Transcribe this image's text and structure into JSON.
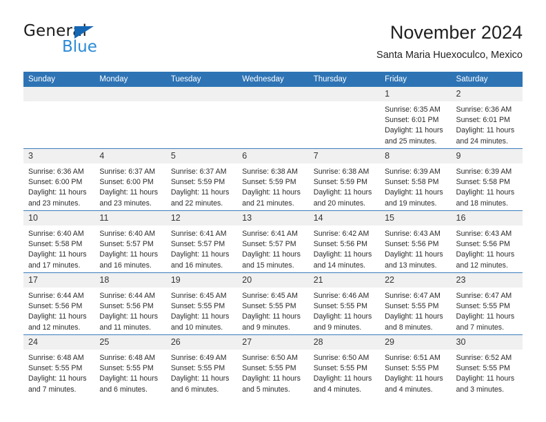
{
  "brand": {
    "name_part1": "General",
    "name_part2": "Blue",
    "triangle_icon": "triangle-icon",
    "colors": {
      "dark": "#1b1b1b",
      "blue": "#2b8ad6",
      "triangle": "#1567b3"
    }
  },
  "header": {
    "title": "November 2024",
    "subtitle": "Santa Maria Huexoculco, Mexico"
  },
  "calendar": {
    "accent_color": "#2e74b5",
    "daynum_band_color": "#f0f0f0",
    "weekdays": [
      "Sunday",
      "Monday",
      "Tuesday",
      "Wednesday",
      "Thursday",
      "Friday",
      "Saturday"
    ],
    "weeks": [
      [
        {
          "day": "",
          "sunrise": "",
          "sunset": "",
          "daylight": "",
          "empty": true
        },
        {
          "day": "",
          "sunrise": "",
          "sunset": "",
          "daylight": "",
          "empty": true
        },
        {
          "day": "",
          "sunrise": "",
          "sunset": "",
          "daylight": "",
          "empty": true
        },
        {
          "day": "",
          "sunrise": "",
          "sunset": "",
          "daylight": "",
          "empty": true
        },
        {
          "day": "",
          "sunrise": "",
          "sunset": "",
          "daylight": "",
          "empty": true
        },
        {
          "day": "1",
          "sunrise": "Sunrise: 6:35 AM",
          "sunset": "Sunset: 6:01 PM",
          "daylight": "Daylight: 11 hours and 25 minutes."
        },
        {
          "day": "2",
          "sunrise": "Sunrise: 6:36 AM",
          "sunset": "Sunset: 6:01 PM",
          "daylight": "Daylight: 11 hours and 24 minutes."
        }
      ],
      [
        {
          "day": "3",
          "sunrise": "Sunrise: 6:36 AM",
          "sunset": "Sunset: 6:00 PM",
          "daylight": "Daylight: 11 hours and 23 minutes."
        },
        {
          "day": "4",
          "sunrise": "Sunrise: 6:37 AM",
          "sunset": "Sunset: 6:00 PM",
          "daylight": "Daylight: 11 hours and 23 minutes."
        },
        {
          "day": "5",
          "sunrise": "Sunrise: 6:37 AM",
          "sunset": "Sunset: 5:59 PM",
          "daylight": "Daylight: 11 hours and 22 minutes."
        },
        {
          "day": "6",
          "sunrise": "Sunrise: 6:38 AM",
          "sunset": "Sunset: 5:59 PM",
          "daylight": "Daylight: 11 hours and 21 minutes."
        },
        {
          "day": "7",
          "sunrise": "Sunrise: 6:38 AM",
          "sunset": "Sunset: 5:59 PM",
          "daylight": "Daylight: 11 hours and 20 minutes."
        },
        {
          "day": "8",
          "sunrise": "Sunrise: 6:39 AM",
          "sunset": "Sunset: 5:58 PM",
          "daylight": "Daylight: 11 hours and 19 minutes."
        },
        {
          "day": "9",
          "sunrise": "Sunrise: 6:39 AM",
          "sunset": "Sunset: 5:58 PM",
          "daylight": "Daylight: 11 hours and 18 minutes."
        }
      ],
      [
        {
          "day": "10",
          "sunrise": "Sunrise: 6:40 AM",
          "sunset": "Sunset: 5:58 PM",
          "daylight": "Daylight: 11 hours and 17 minutes."
        },
        {
          "day": "11",
          "sunrise": "Sunrise: 6:40 AM",
          "sunset": "Sunset: 5:57 PM",
          "daylight": "Daylight: 11 hours and 16 minutes."
        },
        {
          "day": "12",
          "sunrise": "Sunrise: 6:41 AM",
          "sunset": "Sunset: 5:57 PM",
          "daylight": "Daylight: 11 hours and 16 minutes."
        },
        {
          "day": "13",
          "sunrise": "Sunrise: 6:41 AM",
          "sunset": "Sunset: 5:57 PM",
          "daylight": "Daylight: 11 hours and 15 minutes."
        },
        {
          "day": "14",
          "sunrise": "Sunrise: 6:42 AM",
          "sunset": "Sunset: 5:56 PM",
          "daylight": "Daylight: 11 hours and 14 minutes."
        },
        {
          "day": "15",
          "sunrise": "Sunrise: 6:43 AM",
          "sunset": "Sunset: 5:56 PM",
          "daylight": "Daylight: 11 hours and 13 minutes."
        },
        {
          "day": "16",
          "sunrise": "Sunrise: 6:43 AM",
          "sunset": "Sunset: 5:56 PM",
          "daylight": "Daylight: 11 hours and 12 minutes."
        }
      ],
      [
        {
          "day": "17",
          "sunrise": "Sunrise: 6:44 AM",
          "sunset": "Sunset: 5:56 PM",
          "daylight": "Daylight: 11 hours and 12 minutes."
        },
        {
          "day": "18",
          "sunrise": "Sunrise: 6:44 AM",
          "sunset": "Sunset: 5:56 PM",
          "daylight": "Daylight: 11 hours and 11 minutes."
        },
        {
          "day": "19",
          "sunrise": "Sunrise: 6:45 AM",
          "sunset": "Sunset: 5:55 PM",
          "daylight": "Daylight: 11 hours and 10 minutes."
        },
        {
          "day": "20",
          "sunrise": "Sunrise: 6:45 AM",
          "sunset": "Sunset: 5:55 PM",
          "daylight": "Daylight: 11 hours and 9 minutes."
        },
        {
          "day": "21",
          "sunrise": "Sunrise: 6:46 AM",
          "sunset": "Sunset: 5:55 PM",
          "daylight": "Daylight: 11 hours and 9 minutes."
        },
        {
          "day": "22",
          "sunrise": "Sunrise: 6:47 AM",
          "sunset": "Sunset: 5:55 PM",
          "daylight": "Daylight: 11 hours and 8 minutes."
        },
        {
          "day": "23",
          "sunrise": "Sunrise: 6:47 AM",
          "sunset": "Sunset: 5:55 PM",
          "daylight": "Daylight: 11 hours and 7 minutes."
        }
      ],
      [
        {
          "day": "24",
          "sunrise": "Sunrise: 6:48 AM",
          "sunset": "Sunset: 5:55 PM",
          "daylight": "Daylight: 11 hours and 7 minutes."
        },
        {
          "day": "25",
          "sunrise": "Sunrise: 6:48 AM",
          "sunset": "Sunset: 5:55 PM",
          "daylight": "Daylight: 11 hours and 6 minutes."
        },
        {
          "day": "26",
          "sunrise": "Sunrise: 6:49 AM",
          "sunset": "Sunset: 5:55 PM",
          "daylight": "Daylight: 11 hours and 6 minutes."
        },
        {
          "day": "27",
          "sunrise": "Sunrise: 6:50 AM",
          "sunset": "Sunset: 5:55 PM",
          "daylight": "Daylight: 11 hours and 5 minutes."
        },
        {
          "day": "28",
          "sunrise": "Sunrise: 6:50 AM",
          "sunset": "Sunset: 5:55 PM",
          "daylight": "Daylight: 11 hours and 4 minutes."
        },
        {
          "day": "29",
          "sunrise": "Sunrise: 6:51 AM",
          "sunset": "Sunset: 5:55 PM",
          "daylight": "Daylight: 11 hours and 4 minutes."
        },
        {
          "day": "30",
          "sunrise": "Sunrise: 6:52 AM",
          "sunset": "Sunset: 5:55 PM",
          "daylight": "Daylight: 11 hours and 3 minutes."
        }
      ]
    ]
  }
}
